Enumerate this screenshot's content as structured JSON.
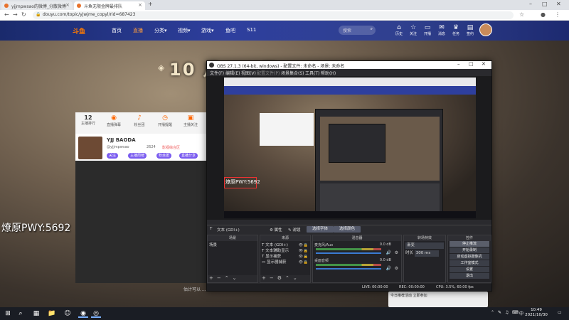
{
  "browser": {
    "tabs": [
      {
        "label": "yjjmpwsao的微博_分散微博",
        "active": false
      },
      {
        "label": "斗鱼无限金牌最排队",
        "active": true
      }
    ],
    "new_tab": "+",
    "url": "douyu.com/topic/yjwjme_copyl/rid=687423",
    "win_min": "–",
    "win_max": "□",
    "win_close": "✕"
  },
  "site": {
    "logo": "斗鱼",
    "nav": [
      "首页",
      "直播",
      "分类▾",
      "视频▾",
      "游戏▾",
      "鱼吧",
      "S11"
    ],
    "active_nav": 1,
    "search_placeholder": "搜索",
    "header_icons": [
      {
        "glyph": "⌂",
        "label": "历史"
      },
      {
        "glyph": "☆",
        "label": "关注"
      },
      {
        "glyph": "▭",
        "label": "开播"
      },
      {
        "glyph": "✉",
        "label": "消息"
      },
      {
        "glyph": "♛",
        "label": "任务"
      },
      {
        "glyph": "▤",
        "label": "签约"
      }
    ],
    "hero_title": "10 月 ··· 日 ···",
    "stats": [
      {
        "num": "12",
        "icon": "",
        "label": "主播排行"
      },
      {
        "num": "",
        "icon": "◉",
        "label": "直播弹幕"
      },
      {
        "num": "",
        "icon": "♪",
        "label": "粉丝团"
      },
      {
        "num": "",
        "icon": "◷",
        "label": "开播提醒"
      },
      {
        "num": "",
        "icon": "▣",
        "label": "主播关注"
      }
    ],
    "streamer": {
      "name": "YJJ BAODA",
      "tag1": "@yjjmpwsao",
      "tag2": "2624",
      "tag3": "影视综合区",
      "buttons": [
        "关注",
        "主播周榜",
        "粉丝团",
        "直播分享"
      ]
    },
    "overlay_text": "燎原PWY:5692",
    "sub_text": "估计可以 ...",
    "right_card": "今日推荐活动 立即参加"
  },
  "obs": {
    "title": "OBS 27.1.3 (64-bit, windows) - 配置文件: 未命名 - 场景: 未命名",
    "menu": [
      "文件(F)",
      "编辑(E)",
      "视图(V)",
      "配置文件(P)",
      "场景集合(S)",
      "工具(T)",
      "帮助(H)"
    ],
    "preview_overlay": "燎原PWY:5692",
    "source_bar": {
      "source_label": "文本 (GDI+)",
      "properties": "⚙ 属性",
      "filters": "✎ 滤镜",
      "select_font": "选择字体",
      "select_color": "选择颜色"
    },
    "docks": {
      "scenes": {
        "title": "场景",
        "items": [
          "场景"
        ]
      },
      "sources": {
        "title": "来源",
        "items": [
          "文本 (GDI+)",
          "文本辅助显示",
          "显示捕获",
          "显示器捕获"
        ]
      },
      "mixer": {
        "title": "混音器",
        "tracks": [
          {
            "name": "麦克风/Aux",
            "db": "0.0 dB"
          },
          {
            "name": "桌面音频",
            "db": "0.0 dB"
          }
        ]
      },
      "transitions": {
        "title": "转场特效",
        "type": "渐变",
        "duration_label": "时长",
        "duration": "300 ms"
      },
      "controls": {
        "title": "控件",
        "buttons": [
          "停止推流",
          "开始录制",
          "启动虚拟摄像机",
          "工作室模式",
          "设置",
          "退出"
        ]
      }
    },
    "status": {
      "live": "LIVE: 00:00:00",
      "rec": "REC: 00:00:00",
      "cpu": "CPU: 3.5%, 60.00 fps"
    }
  },
  "taskbar": {
    "start": "⊞",
    "apps": [
      "⌕",
      "▦",
      "📁",
      "☺",
      "◉",
      "◎"
    ],
    "tray": [
      "⌃",
      "✎",
      "♫",
      "⌨",
      "中"
    ],
    "time": "10:49",
    "date": "2021/10/30"
  }
}
